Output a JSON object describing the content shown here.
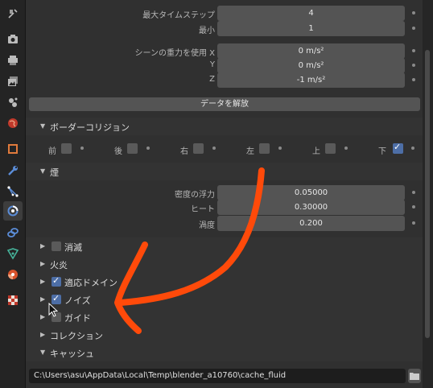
{
  "sidebar": {
    "tabs": [
      {
        "name": "tool-tab",
        "icon": "wrench-screwdriver-icon"
      },
      {
        "name": "render-tab",
        "icon": "camera-back-icon"
      },
      {
        "name": "output-tab",
        "icon": "printer-icon"
      },
      {
        "name": "view-layer-tab",
        "icon": "image-stack-icon"
      },
      {
        "name": "scene-tab",
        "icon": "scene-icon"
      },
      {
        "name": "world-tab",
        "icon": "globe-icon"
      },
      {
        "name": "object-tab",
        "icon": "square-object-icon"
      },
      {
        "name": "modifier-tab",
        "icon": "wrench-icon"
      },
      {
        "name": "particles-tab",
        "icon": "particles-icon"
      },
      {
        "name": "physics-tab",
        "icon": "physics-icon",
        "active": true
      },
      {
        "name": "constraints-tab",
        "icon": "constraint-icon"
      },
      {
        "name": "data-tab",
        "icon": "data-icon"
      },
      {
        "name": "material-tab",
        "icon": "material-sphere-icon"
      },
      {
        "name": "texture-tab",
        "icon": "checker-texture-icon"
      }
    ]
  },
  "timestep": {
    "max_label": "最大タイムステップ",
    "max_value": "4",
    "min_label": "最小",
    "min_value": "1"
  },
  "gravity": {
    "x_label": "シーンの重力を使用 X",
    "x_value": "0 m/s²",
    "y_label": "Y",
    "y_value": "0 m/s²",
    "z_label": "Z",
    "z_value": "-1 m/s²"
  },
  "free_data_button": "データを解放",
  "border_collisions": {
    "title": "ボーダーコリジョン",
    "items": [
      {
        "label": "前",
        "checked": false
      },
      {
        "label": "後",
        "checked": false
      },
      {
        "label": "右",
        "checked": false
      },
      {
        "label": "左",
        "checked": false
      },
      {
        "label": "上",
        "checked": false
      },
      {
        "label": "下",
        "checked": true
      }
    ]
  },
  "smoke": {
    "title": "煙",
    "density_label": "密度の浮力",
    "density_value": "0.05000",
    "heat_label": "ヒート",
    "heat_value": "0.30000",
    "vorticity_label": "渦度",
    "vorticity_value": "0.200"
  },
  "panels": {
    "dissolve": {
      "label": "消滅",
      "checked": false
    },
    "fire": {
      "label": "火炎"
    },
    "adaptive": {
      "label": "適応ドメイン",
      "checked": true
    },
    "noise": {
      "label": "ノイズ",
      "checked": true
    },
    "guides": {
      "label": "ガイド",
      "checked": false
    },
    "collections": {
      "label": "コレクション"
    },
    "cache": {
      "label": "キャッシュ"
    }
  },
  "cache_path": "C:\\Users\\asu\\AppData\\Local\\Temp\\blender_a10760\\cache_fluid",
  "colors": {
    "accent": "#4d6ea6",
    "annotation_arrow": "#ff4a0a"
  }
}
